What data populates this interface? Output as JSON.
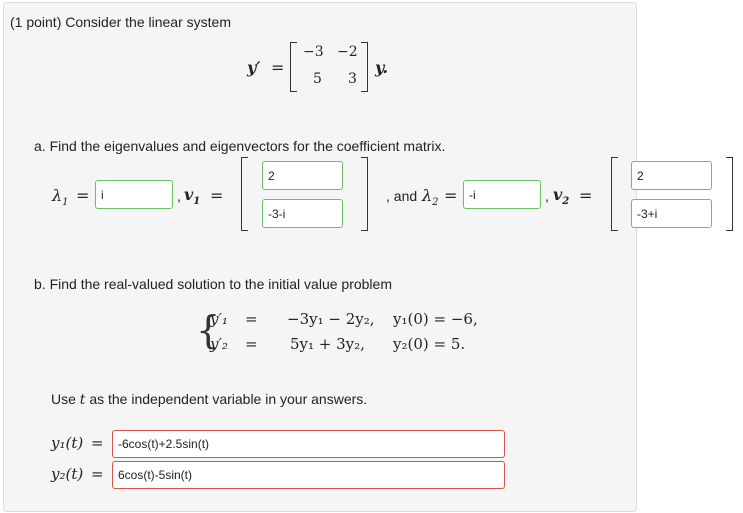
{
  "header": {
    "text": "(1 point) Consider the linear system"
  },
  "system": {
    "lhs": "y′",
    "eq": "=",
    "matrix": [
      [
        "−3",
        "−2"
      ],
      [
        "5",
        "3"
      ]
    ],
    "rhs": "y."
  },
  "part_a": {
    "prompt": "a. Find the eigenvalues and eigenvectors for the coefficient matrix.",
    "lambda1_label": "λ",
    "lambda1_sub": "1",
    "lambda1_value": "i",
    "v1_label": "v",
    "v1_sub": "1",
    "v1_values": [
      "2",
      "-3-i"
    ],
    "and_text": ", and",
    "lambda2_label": "λ",
    "lambda2_sub": "2",
    "lambda2_value": "-i",
    "v2_label": "v",
    "v2_sub": "2",
    "v2_values": [
      "2",
      "-3+i"
    ],
    "comma": ","
  },
  "part_b": {
    "prompt": "b. Find the real-valued solution to the initial value problem",
    "eq1_lhs": "y′₁",
    "eq1_rhs": "−3y₁ − 2y₂,",
    "ic1": "y₁(0) = −6,",
    "eq2_lhs": "y′₂",
    "eq2_rhs": "5y₁ + 3y₂,",
    "ic2": "y₂(0) = 5.",
    "eq": "=",
    "use_t_prefix": "Use",
    "use_t_var": "t",
    "use_t_suffix": "as the independent variable in your answers.",
    "y1_label": "y₁(t)",
    "y1_value": "-6cos(t)+2.5sin(t)",
    "y2_label": "y₂(t)",
    "y2_value": "6cos(t)-5sin(t)"
  }
}
